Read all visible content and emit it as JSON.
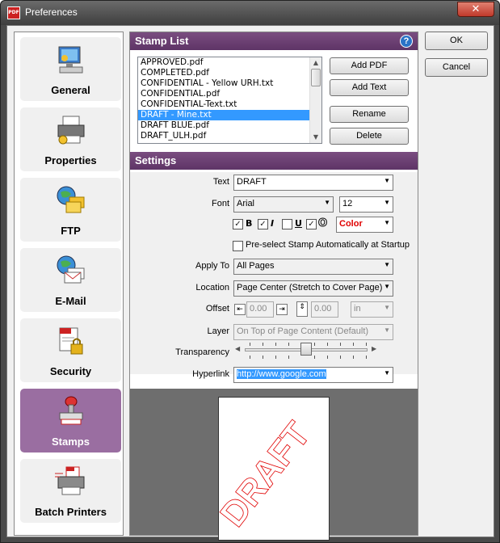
{
  "window": {
    "title": "Preferences",
    "icon_label": "PDF"
  },
  "categories": [
    {
      "label": "General",
      "icon": "computer-icon"
    },
    {
      "label": "Properties",
      "icon": "printer-icon"
    },
    {
      "label": "FTP",
      "icon": "globe-folders-icon"
    },
    {
      "label": "E-Mail",
      "icon": "globe-mail-icon"
    },
    {
      "label": "Security",
      "icon": "pdf-lock-icon"
    },
    {
      "label": "Stamps",
      "icon": "stamp-icon"
    },
    {
      "label": "Batch Printers",
      "icon": "batch-printer-icon"
    }
  ],
  "stamp_list": {
    "header": "Stamp List",
    "items": [
      "APPROVED.pdf",
      "COMPLETED.pdf",
      "CONFIDENTIAL - Yellow URH.txt",
      "CONFIDENTIAL.pdf",
      "CONFIDENTIAL-Text.txt",
      "DRAFT - Mine.txt",
      "DRAFT BLUE.pdf",
      "DRAFT_ULH.pdf"
    ],
    "selected_index": 5,
    "add_pdf": "Add PDF",
    "add_text": "Add Text",
    "rename": "Rename",
    "delete": "Delete"
  },
  "settings": {
    "header": "Settings",
    "text_label": "Text",
    "text_value": "DRAFT",
    "font_label": "Font",
    "font_value": "Arial",
    "font_size": "12",
    "bold": "B",
    "italic": "I",
    "underline": "U",
    "outline": "O",
    "color_value": "Color",
    "color_hex": "#e00000",
    "preselect_label": "Pre-select Stamp Automatically at Startup",
    "apply_to_label": "Apply To",
    "apply_to_value": "All Pages",
    "location_label": "Location",
    "location_value": "Page Center (Stretch to Cover Page)",
    "offset_label": "Offset",
    "offset_x": "0.00",
    "offset_y": "0.00",
    "offset_unit": "in",
    "layer_label": "Layer",
    "layer_value": "On Top of Page Content (Default)",
    "transparency_label": "Transparency",
    "transparency_level": 0.5,
    "hyperlink_label": "Hyperlink",
    "hyperlink_value": "http://www.google.com"
  },
  "preview": {
    "stamp_text": "DRAFT"
  },
  "buttons": {
    "ok": "OK",
    "cancel": "Cancel"
  },
  "colors": {
    "accent": "#7a4d80",
    "selection": "#3399ff"
  }
}
